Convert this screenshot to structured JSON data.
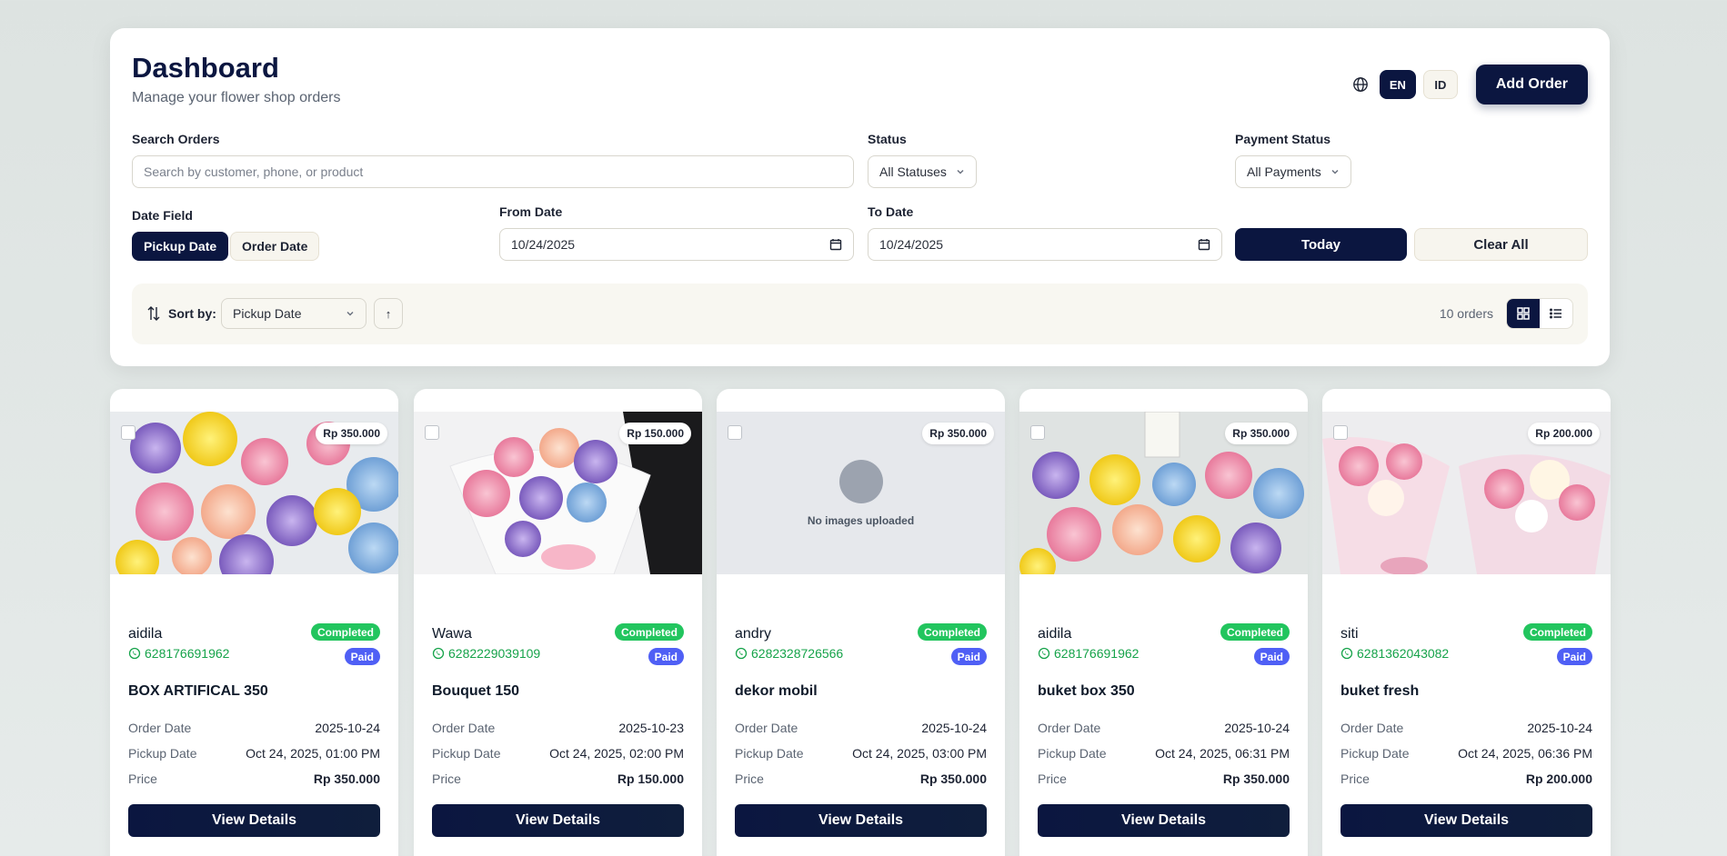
{
  "header": {
    "title": "Dashboard",
    "subtitle": "Manage your flower shop orders",
    "lang_en": "EN",
    "lang_id": "ID",
    "add_order": "Add Order"
  },
  "filters": {
    "search_label": "Search Orders",
    "search_placeholder": "Search by customer, phone, or product",
    "status_label": "Status",
    "status_value": "All Statuses",
    "payment_label": "Payment Status",
    "payment_value": "All Payments",
    "date_field_label": "Date Field",
    "date_field_options": [
      "Pickup Date",
      "Order Date"
    ],
    "from_label": "From Date",
    "from_value": "10/24/2025",
    "to_label": "To Date",
    "to_value": "10/24/2025",
    "today": "Today",
    "clear_all": "Clear All"
  },
  "sortbar": {
    "label": "Sort by:",
    "value": "Pickup Date",
    "direction": "↑",
    "count": "10 orders"
  },
  "card_labels": {
    "order_date": "Order Date",
    "pickup_date": "Pickup Date",
    "price": "Price",
    "view_details": "View Details",
    "no_images": "No images uploaded"
  },
  "orders": [
    {
      "price_tag": "Rp 350.000",
      "customer": "aidila",
      "phone": "628176691962",
      "status": "Completed",
      "payment": "Paid",
      "product": "BOX ARTIFICAL 350",
      "order_date": "2025-10-24",
      "pickup_date": "Oct 24, 2025, 01:00 PM",
      "price": "Rp 350.000"
    },
    {
      "price_tag": "Rp 150.000",
      "customer": "Wawa",
      "phone": "6282229039109",
      "status": "Completed",
      "payment": "Paid",
      "product": "Bouquet 150",
      "order_date": "2025-10-23",
      "pickup_date": "Oct 24, 2025, 02:00 PM",
      "price": "Rp 150.000"
    },
    {
      "price_tag": "Rp 350.000",
      "customer": "andry",
      "phone": "6282328726566",
      "status": "Completed",
      "payment": "Paid",
      "product": "dekor mobil",
      "order_date": "2025-10-24",
      "pickup_date": "Oct 24, 2025, 03:00 PM",
      "price": "Rp 350.000"
    },
    {
      "price_tag": "Rp 350.000",
      "customer": "aidila",
      "phone": "628176691962",
      "status": "Completed",
      "payment": "Paid",
      "product": "buket box 350",
      "order_date": "2025-10-24",
      "pickup_date": "Oct 24, 2025, 06:31 PM",
      "price": "Rp 350.000"
    },
    {
      "price_tag": "Rp 200.000",
      "customer": "siti",
      "phone": "6281362043082",
      "status": "Completed",
      "payment": "Paid",
      "product": "buket fresh",
      "order_date": "2025-10-24",
      "pickup_date": "Oct 24, 2025, 06:36 PM",
      "price": "Rp 200.000"
    }
  ]
}
